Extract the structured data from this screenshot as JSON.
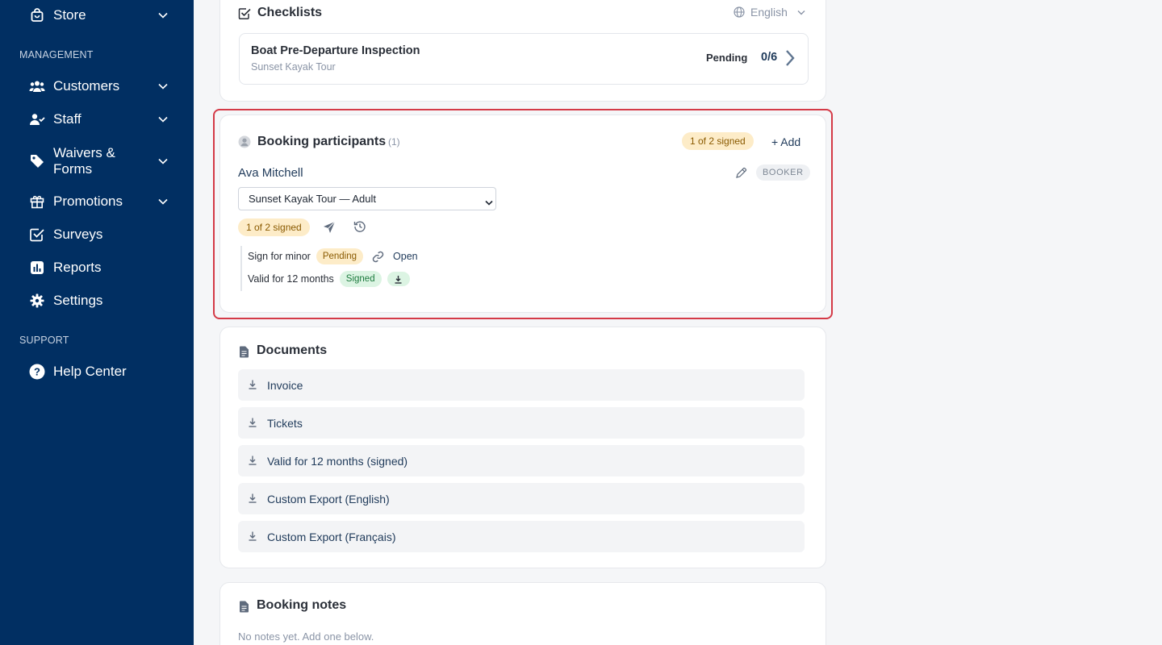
{
  "sidebar": {
    "items_top": [
      {
        "label": "Store",
        "icon": "bag-icon",
        "has_chevron": true
      }
    ],
    "management_title": "MANAGEMENT",
    "management_items": [
      {
        "label": "Customers",
        "icon": "users-icon"
      },
      {
        "label": "Staff",
        "icon": "staff-icon"
      },
      {
        "label": "Waivers &",
        "label2": "Forms",
        "icon": "tag-icon"
      },
      {
        "label": "Promotions",
        "icon": "gift-icon"
      },
      {
        "label": "Surveys",
        "icon": "checkbox-icon"
      },
      {
        "label": "Reports",
        "icon": "chart-icon"
      },
      {
        "label": "Settings",
        "icon": "gear-icon"
      }
    ],
    "support_title": "SUPPORT",
    "support_items": [
      {
        "label": "Help Center",
        "icon": "help-icon"
      }
    ]
  },
  "checklists": {
    "title": "Checklists",
    "language": "English",
    "item": {
      "name": "Boat Pre-Departure Inspection",
      "subtitle": "Sunset Kayak Tour",
      "status": "Pending",
      "progress": "0/6"
    }
  },
  "participants": {
    "title": "Booking participants",
    "count": "(1)",
    "signed_badge": "1 of 2 signed",
    "add_label": "+ Add",
    "participant": {
      "name": "Ava Mitchell",
      "role": "BOOKER",
      "ticket_selected": "Sunset Kayak Tour — Adult",
      "signed_badge": "1 of 2 signed",
      "waivers": [
        {
          "name": "Sign for minor",
          "status": "Pending",
          "action": "Open"
        },
        {
          "name": "Valid for 12 months",
          "status": "Signed"
        }
      ]
    }
  },
  "documents": {
    "title": "Documents",
    "items": [
      "Invoice",
      "Tickets",
      "Valid for 12 months (signed)",
      "Custom Export (English)",
      "Custom Export (Français)"
    ]
  },
  "notes": {
    "title": "Booking notes",
    "empty_text": "No notes yet. Add one below."
  },
  "colors": {
    "sidebar_bg": "#012f62",
    "highlight": "#d43a47",
    "pending_bg": "#fdecc8",
    "signed_bg": "#dcf4e3"
  }
}
